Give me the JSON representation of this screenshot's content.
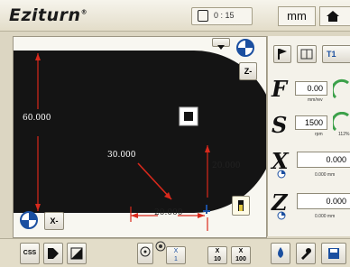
{
  "header": {
    "logo": "Eziturn",
    "logo_mark": "®",
    "counter": "0 : 15",
    "units": "mm",
    "home_icon": "home-icon"
  },
  "canvas": {
    "dimensions": {
      "height": "60.000",
      "radius": "30.000",
      "width": "20.000",
      "vertical": "20.000"
    },
    "view_selector_label": "X-",
    "z_selector_label": "Z-"
  },
  "panel": {
    "tool_label": "T1",
    "feed_label": "F",
    "feed_value": "0.00",
    "feed_unit": "mm/rev",
    "speed_label": "S",
    "speed_value": "1500",
    "speed_unit": "rpm",
    "speed_extra": "112%",
    "x_label": "X",
    "x_value": "0.000",
    "x_sub": "0.000 mm",
    "z_label": "Z",
    "z_value": "0.000",
    "z_sub": "0.000 mm"
  },
  "bottom": {
    "css_label": "CSS",
    "step1": "1",
    "step10": "10",
    "step100": "100",
    "step_x": "X"
  },
  "colors": {
    "part": "#141414",
    "dimension": "#d9291c",
    "accent_blue": "#1b4fa0"
  }
}
